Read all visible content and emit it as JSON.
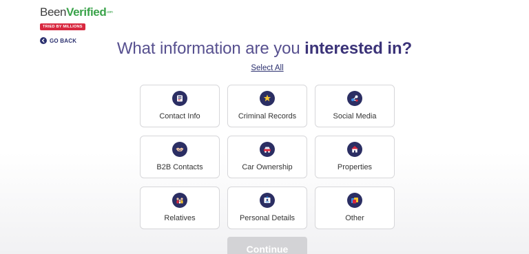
{
  "logo": {
    "been": "Been",
    "verified": "Verified",
    "com": ".com",
    "badge": "TRIED BY MILLIONS"
  },
  "nav": {
    "go_back": "GO BACK"
  },
  "heading": {
    "title_plain": "What information are you ",
    "title_bold": "interested in?"
  },
  "select_all": "Select All",
  "options": [
    {
      "label": "Contact Info",
      "icon": "contact-card-icon"
    },
    {
      "label": "Criminal Records",
      "icon": "sheriff-badge-icon"
    },
    {
      "label": "Social Media",
      "icon": "social-network-icon"
    },
    {
      "label": "B2B Contacts",
      "icon": "handshake-icon"
    },
    {
      "label": "Car Ownership",
      "icon": "car-icon"
    },
    {
      "label": "Properties",
      "icon": "house-icon"
    },
    {
      "label": "Relatives",
      "icon": "family-icon"
    },
    {
      "label": "Personal Details",
      "icon": "id-badge-icon"
    },
    {
      "label": "Other",
      "icon": "folders-icon"
    }
  ],
  "continue_label": "Continue",
  "colors": {
    "brand_green": "#3aa34a",
    "badge_red": "#d8283f",
    "title_purple": "#57508f",
    "icon_navy": "#2b2e63",
    "button_disabled": "#d3d3d6"
  }
}
